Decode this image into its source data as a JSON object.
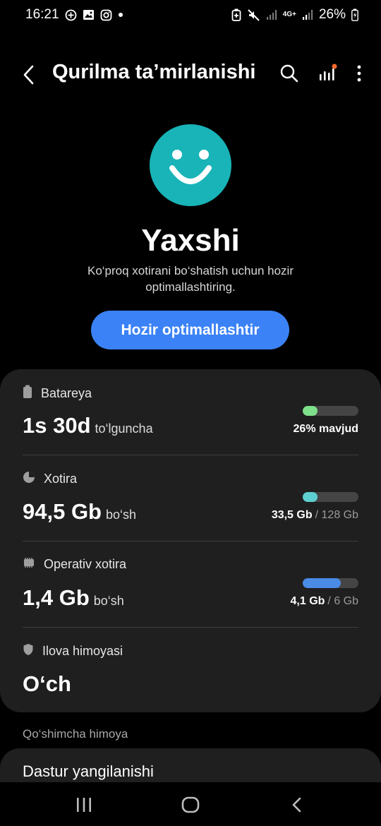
{
  "status_bar": {
    "time": "16:21",
    "network": "4G+",
    "battery": "26%",
    "left_icons": [
      "add-circle-icon",
      "image-icon",
      "instagram-icon",
      "dot-icon"
    ],
    "right_icons": [
      "battery-saver-icon",
      "mute-icon",
      "signal-icon",
      "signal-icon",
      "battery-icon"
    ]
  },
  "app_bar": {
    "title": "Qurilma ta’mirlanishi",
    "icons": [
      "back-icon",
      "search-icon",
      "stats-icon",
      "more-icon"
    ],
    "notification_dot_color": "#ff6a2a"
  },
  "status": {
    "title": "Yaxshi",
    "description": "Ko‘proq xotirani bo‘shatish uchun hozir optimallashtiring.",
    "face_color": "#18b4b8",
    "button_label": "Hozir optimallashtir",
    "button_color": "#3b82f6"
  },
  "items": [
    {
      "label": "Batareya",
      "icon": "battery-icon",
      "value": "1s 30d",
      "unit": "to‘lguncha",
      "bar_fraction": 0.26,
      "bar_color": "#7ee08a",
      "meta_strong": "26% mavjud",
      "meta_rest": ""
    },
    {
      "label": "Xotira",
      "icon": "storage-pie-icon",
      "value": "94,5 Gb",
      "unit": "bo‘sh",
      "bar_fraction": 0.26,
      "bar_color": "#5ecfd0",
      "meta_strong": "33,5 Gb",
      "meta_rest": "/ 128 Gb"
    },
    {
      "label": "Operativ xotira",
      "icon": "memory-chip-icon",
      "value": "1,4 Gb",
      "unit": "bo‘sh",
      "bar_fraction": 0.68,
      "bar_color": "#4a8be6",
      "meta_strong": "4,1 Gb",
      "meta_rest": "/ 6 Gb"
    },
    {
      "label": "Ilova himoyasi",
      "icon": "shield-icon",
      "value": "O‘ch",
      "unit": "",
      "bar_fraction": null,
      "bar_color": "",
      "meta_strong": "",
      "meta_rest": ""
    }
  ],
  "section": {
    "label": "Qo‘shimcha himoya",
    "item_label": "Dastur yangilanishi"
  },
  "nav_bar": {
    "icons": [
      "recents-icon",
      "home-icon",
      "back-icon"
    ]
  }
}
